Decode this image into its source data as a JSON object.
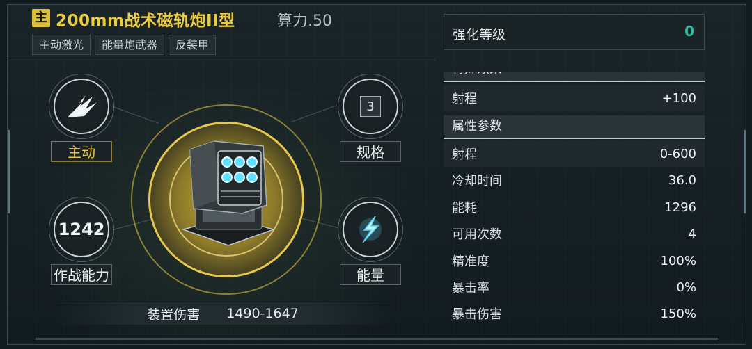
{
  "header": {
    "badge": "主",
    "title": "200mm战术磁轨炮II型",
    "power": "算力.50",
    "tags": [
      "主动激光",
      "能量炮武器",
      "反装甲"
    ]
  },
  "slots": {
    "mode_label": "主动",
    "spec_value": "3",
    "spec_label": "规格",
    "combat_value": "1242",
    "combat_label": "作战能力",
    "energy_label": "能量"
  },
  "damage": {
    "label": "装置伤害",
    "value": "1490-1647"
  },
  "enhance": {
    "label": "强化等级",
    "value": "0"
  },
  "special": {
    "heading": "特殊效果",
    "rows": [
      {
        "name": "射程",
        "value": "+100"
      }
    ]
  },
  "attributes": {
    "heading": "属性参数",
    "rows": [
      {
        "name": "射程",
        "value": "0-600"
      },
      {
        "name": "冷却时间",
        "value": "36.0"
      },
      {
        "name": "能耗",
        "value": "1296"
      },
      {
        "name": "可用次数",
        "value": "4"
      },
      {
        "name": "精准度",
        "value": "100%"
      },
      {
        "name": "暴击率",
        "value": "0%"
      },
      {
        "name": "暴击伤害",
        "value": "150%"
      }
    ]
  },
  "colors": {
    "gold": "#e9cc44",
    "teal": "#27c1a7"
  },
  "icons": [
    "claw-mode-icon",
    "energy-lightning-icon",
    "railgun-weapon-image"
  ]
}
